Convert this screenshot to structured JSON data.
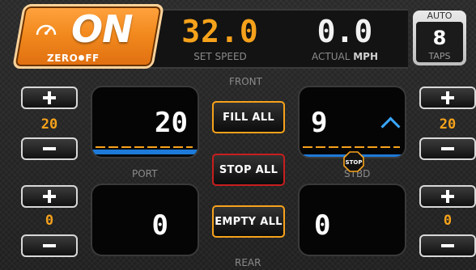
{
  "status": {
    "state": "ON",
    "brand": "ZERO",
    "brand2": "FF"
  },
  "set_speed": {
    "value": "32.0",
    "label": "SET SPEED"
  },
  "actual_speed": {
    "value": "0.0",
    "label": "ACTUAL",
    "unit": "MPH"
  },
  "taps": {
    "mode": "AUTO",
    "value": "8",
    "label": "TAPS"
  },
  "labels": {
    "front": "FRONT",
    "port": "PORT",
    "stbd": "STBD",
    "rear": "REAR"
  },
  "left_top_stepper": {
    "value": "20"
  },
  "left_bottom_stepper": {
    "value": "0"
  },
  "right_top_stepper": {
    "value": "20"
  },
  "right_bottom_stepper": {
    "value": "0"
  },
  "tabs": {
    "port_front": {
      "value": "20"
    },
    "stbd_front": {
      "value": "9",
      "stop_badge": "STOP"
    },
    "port_rear": {
      "value": "0"
    },
    "stbd_rear": {
      "value": "0"
    }
  },
  "actions": {
    "fill_all": "FILL ALL",
    "stop_all": "STOP ALL",
    "empty_all": "EMPTY ALL"
  },
  "colors": {
    "accent": "#f6a21b",
    "on_orange": "#f28a1e",
    "blue_bar": "#1e7ad8",
    "stop_red": "#c81e1e"
  },
  "icons": {
    "gauge": "speedometer-icon",
    "plus": "plus-icon",
    "minus": "minus-icon",
    "caret": "chevron-up-icon",
    "stop": "stop-sign-icon"
  }
}
